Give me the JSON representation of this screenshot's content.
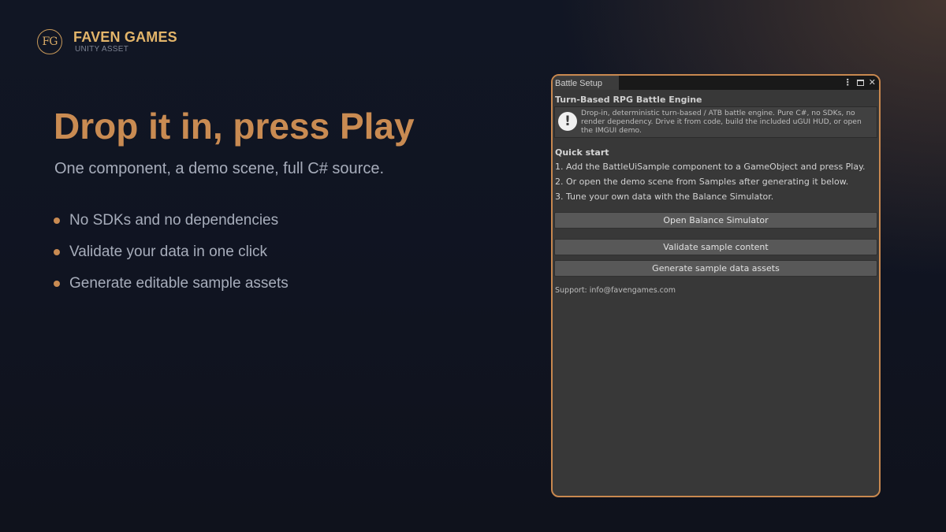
{
  "brand": {
    "logo_text": "FG",
    "name": "FAVEN GAMES",
    "subtitle": "UNITY ASSET"
  },
  "hero": {
    "headline": "Drop it in, press Play",
    "subheadline": "One component, a demo scene, full C# source.",
    "bullets": [
      "No SDKs and no dependencies",
      "Validate your data in one click",
      "Generate editable sample assets"
    ]
  },
  "window": {
    "tab_label": "Battle Setup",
    "icons": [
      "kebab-menu-icon",
      "maximize-icon",
      "close-icon"
    ],
    "title": "Turn-Based RPG Battle Engine",
    "help_icon_glyph": "!",
    "help_text": "Drop-in, deterministic turn-based / ATB battle engine. Pure C#, no SDKs, no render dependency. Drive it from code, build the included uGUI HUD, or open the IMGUI demo.",
    "quick_start_title": "Quick start",
    "steps": [
      "1. Add the BattleUiSample component to a GameObject and press Play.",
      "2. Or open the demo scene from Samples after generating it below.",
      "3. Tune your own data with the Balance Simulator."
    ],
    "buttons": {
      "open_balance": "Open Balance Simulator",
      "validate": "Validate sample content",
      "generate": "Generate sample data assets"
    },
    "support": "Support: info@favengames.com"
  },
  "colors": {
    "accent": "#c98b52",
    "brand_gold": "#e3b56a",
    "window_border": "#c8884f",
    "window_bg": "#383838",
    "background": "#111624"
  }
}
